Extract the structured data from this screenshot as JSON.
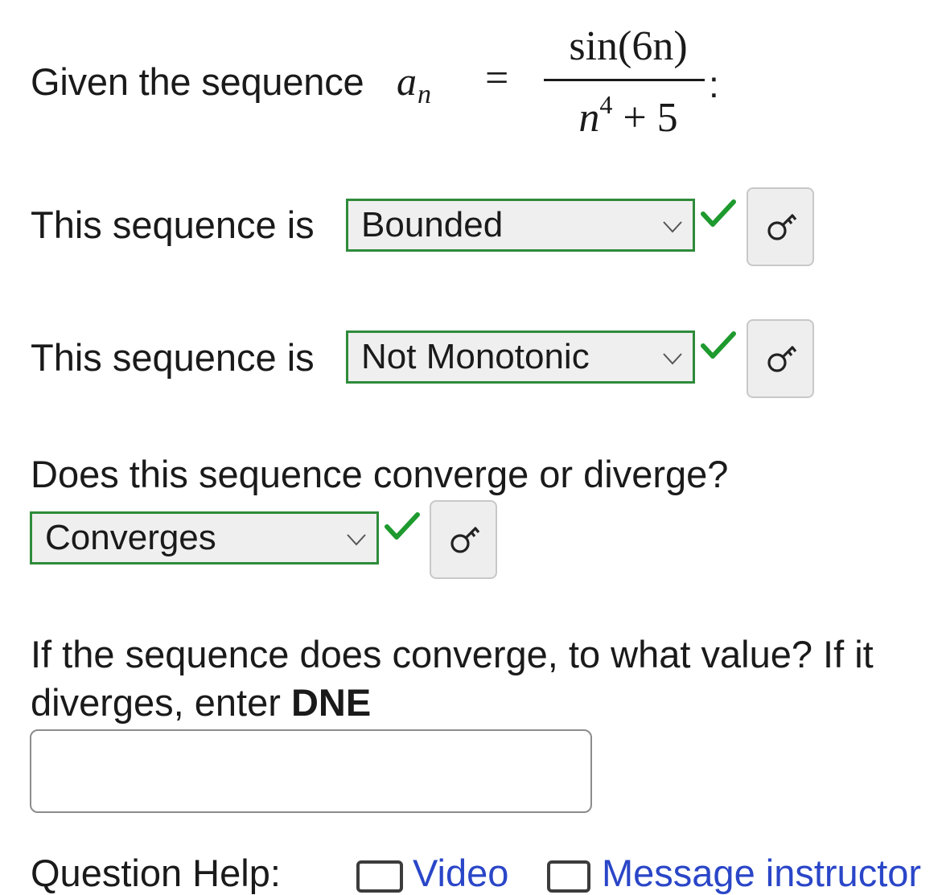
{
  "prompt": {
    "lead": "Given the sequence",
    "var_base": "a",
    "var_sub": "n",
    "equals": "=",
    "numerator": "sin(6n)",
    "denominator_base": "n",
    "denominator_exp": "4",
    "denominator_rest": " + 5",
    "trailing": ":"
  },
  "bounded_row": {
    "label": "This sequence is",
    "selected": "Bounded",
    "status": "correct"
  },
  "monotonic_row": {
    "label": "This sequence is",
    "selected": "Not Monotonic",
    "status": "correct"
  },
  "convergence": {
    "question": "Does this sequence converge or diverge?",
    "selected": "Converges",
    "status": "correct"
  },
  "limit": {
    "question": "If the sequence does converge, to what value? If it",
    "question_line2": "diverges, enter ",
    "question_bold": "DNE",
    "value": "",
    "placeholder": ""
  },
  "help": {
    "label": "Question Help:",
    "video_label": "Video",
    "message_label": "Message instructor"
  },
  "colors": {
    "correct_border": "#2e8b3a",
    "check_green": "#1e9a2e",
    "link_blue": "#2a46c8"
  },
  "icons": {
    "check": "check-icon",
    "key": "key-icon",
    "chevron": "chevron-down-icon"
  }
}
